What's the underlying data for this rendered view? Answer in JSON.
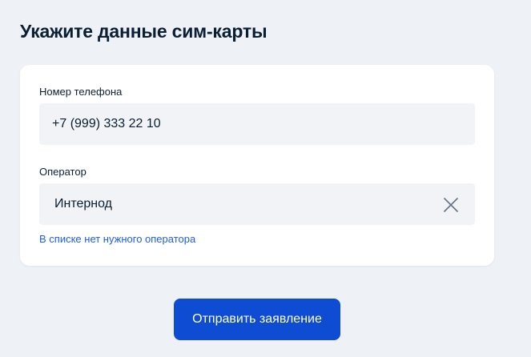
{
  "page": {
    "title": "Укажите данные сим-карты"
  },
  "form": {
    "phone": {
      "label": "Номер телефона",
      "value": "+7 (999) 333 22 10"
    },
    "operator": {
      "label": "Оператор",
      "value": "Интернод",
      "clear_icon": "close-icon"
    },
    "missing_operator_link": "В списке нет нужного оператора"
  },
  "actions": {
    "submit_label": "Отправить заявление"
  },
  "colors": {
    "background": "#eef2f7",
    "card": "#ffffff",
    "input_bg": "#f1f3f6",
    "text": "#0b1f33",
    "link": "#1d5deb",
    "primary": "#0d4cd3",
    "icon": "#66727f"
  }
}
